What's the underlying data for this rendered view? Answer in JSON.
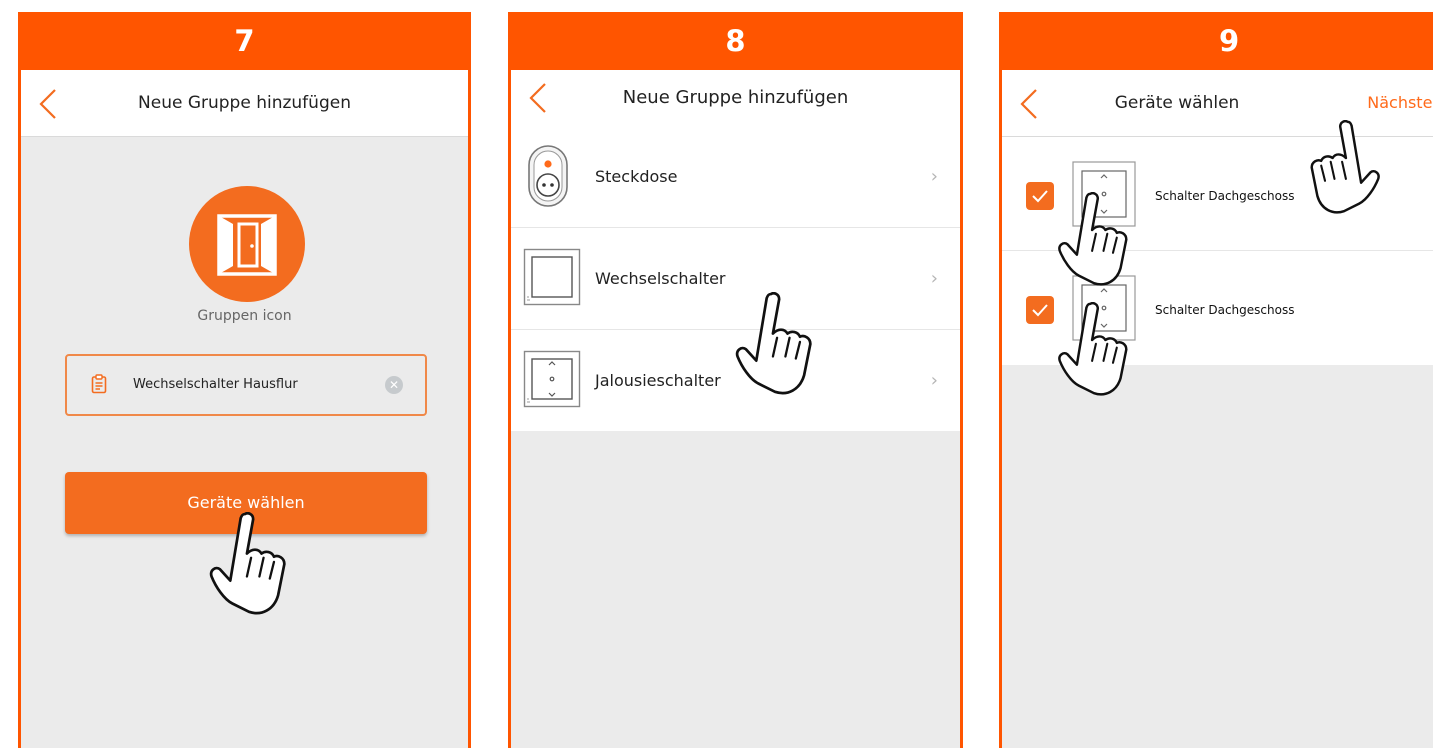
{
  "colors": {
    "accent": "#FF5500",
    "button": "#F36C1F",
    "background": "#EBEBEB"
  },
  "step7": {
    "step_number": "7",
    "header": {
      "title": "Neue Gruppe hinzufügen",
      "back_icon": "chevron-left-icon"
    },
    "group_icon": {
      "icon": "door-icon",
      "label": "Gruppen icon"
    },
    "name_input": {
      "value": "Wechselschalter Hausflur",
      "icon": "clipboard-icon",
      "clear_icon": "clear-icon"
    },
    "select_button": "Geräte wählen"
  },
  "step8": {
    "step_number": "8",
    "header": {
      "title": "Neue Gruppe hinzufügen",
      "back_icon": "chevron-left-icon"
    },
    "device_types": [
      {
        "label": "Steckdose",
        "icon": "socket-icon"
      },
      {
        "label": "Wechselschalter",
        "icon": "toggle-switch-icon"
      },
      {
        "label": "Jalousieschalter",
        "icon": "blind-switch-icon"
      }
    ]
  },
  "step9": {
    "step_number": "9",
    "header": {
      "title": "Geräte wählen",
      "next_label": "Nächster",
      "back_icon": "chevron-left-icon"
    },
    "devices": [
      {
        "name": "Schalter Dachgeschoss",
        "checked": true,
        "icon": "blind-switch-icon"
      },
      {
        "name": "Schalter Dachgeschoss",
        "checked": true,
        "icon": "blind-switch-icon"
      }
    ]
  }
}
